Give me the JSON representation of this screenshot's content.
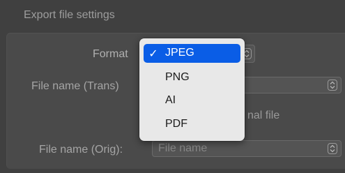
{
  "section": {
    "title": "Export file settings"
  },
  "format": {
    "label": "Format",
    "selected": "JPEG",
    "options": [
      {
        "label": "JPEG",
        "checked": "✓"
      },
      {
        "label": "PNG",
        "checked": ""
      },
      {
        "label": "AI",
        "checked": ""
      },
      {
        "label": "PDF",
        "checked": ""
      }
    ]
  },
  "file_name_trans": {
    "label": "File name (Trans)",
    "value": ""
  },
  "original_file": {
    "label_partial": "nal file"
  },
  "file_name_orig": {
    "label": "File name (Orig):",
    "placeholder": "File name"
  },
  "colors": {
    "background": "#404040",
    "menu_background": "#e8e8e8",
    "menu_highlight": "#0a5de6"
  },
  "icons": {
    "stepper": "up-down-chevron-icon",
    "checkmark": "checkmark-icon"
  }
}
